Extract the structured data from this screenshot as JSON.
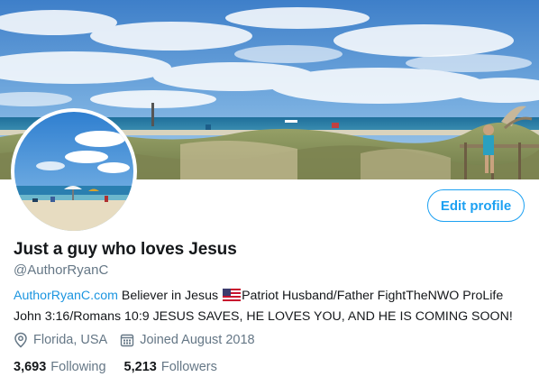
{
  "profile": {
    "display_name": "Just a guy who loves Jesus",
    "handle": "@AuthorRyanC",
    "edit_label": "Edit profile",
    "bio": {
      "link": "AuthorRyanC.com",
      "part1": " Believer in Jesus ",
      "part2": "Patriot Husband/Father FightTheNWO ProLife John 3:16/Romans 10:9 JESUS SAVES, HE LOVES YOU, AND HE IS COMING SOON!"
    },
    "location": "Florida, USA",
    "joined": "Joined August 2018",
    "following": {
      "count": "3,693",
      "label": "Following"
    },
    "followers": {
      "count": "5,213",
      "label": "Followers"
    }
  },
  "icons": {
    "location": "location-pin-icon",
    "calendar": "calendar-icon",
    "flag": "us-flag-icon"
  },
  "colors": {
    "accent": "#1da1f2",
    "link": "#1b95e0",
    "secondary_text": "#657786",
    "primary_text": "#14171a"
  }
}
